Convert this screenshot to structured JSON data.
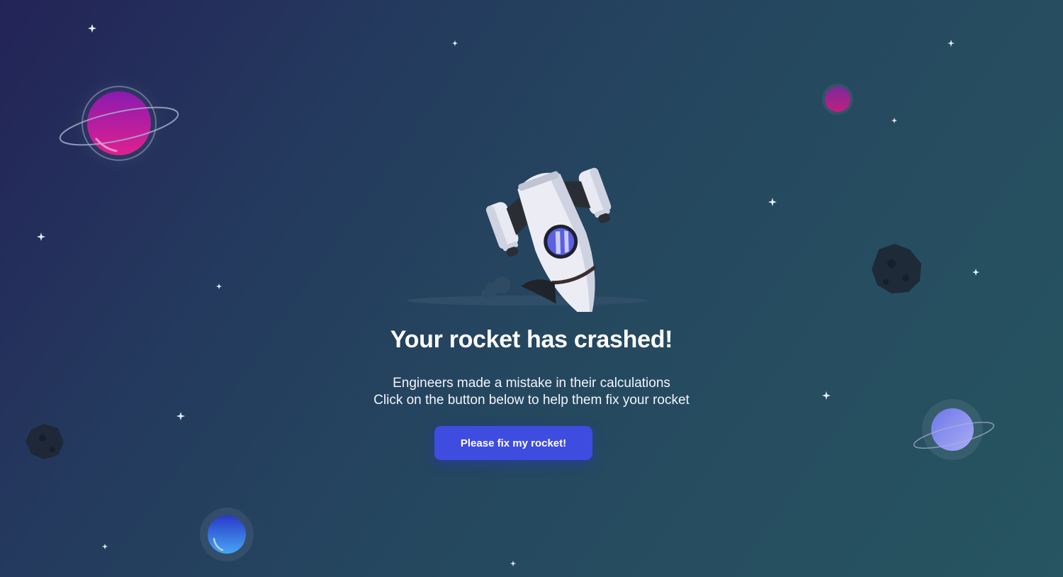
{
  "page": {
    "title": "Your rocket has crashed!",
    "message_line1": "Engineers made a mistake in their calculations",
    "message_line2": "Click on the button below to help them fix your rocket",
    "button_label": "Please fix my rocket!"
  },
  "colors": {
    "background_start": "#232357",
    "background_end": "#275561",
    "button": "#3f4ce0",
    "text": "#ffffff"
  },
  "illustration": {
    "main": "crashed-rocket-icon",
    "decorations": [
      "ringed-planet-magenta",
      "small-planet-magenta",
      "asteroid-icon",
      "ringed-planet-lavender",
      "planet-blue",
      "star-icon"
    ]
  }
}
